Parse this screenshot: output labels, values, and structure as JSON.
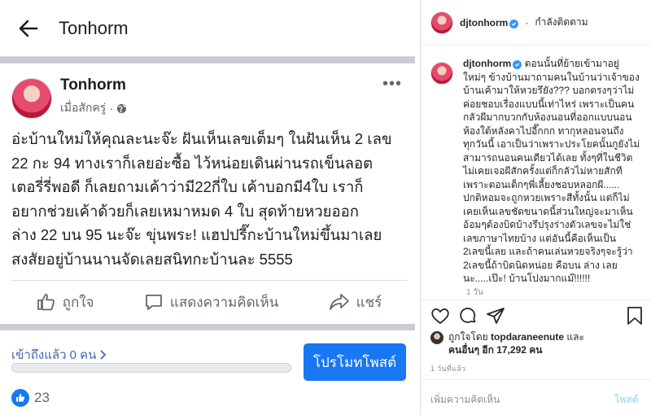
{
  "facebook": {
    "header_title": "Tonhorm",
    "author": "Tonhorm",
    "time": "เมื่อสักครู่",
    "time_sep": "·",
    "body_lines": [
      "อ่ะบ้านใหม่ให้คุณละนะจ๊ะ ฝันเห็นเลขเต็มๆ ในฝันเห็น 2 เลข",
      "22 กะ 94 ทางเราก็เลยอ่ะซื้อ ไว้หน่อยเดินผ่านรถเข็นลอต",
      "เตอรี่รี่พอดี ก็เลยถามเค้าว่ามี22กี่ใบ เค้าบอกมี4ใบ เราก็",
      "อยากช่วยเค้าด้วยก็เลยเหมาหมด 4 ใบ สุดท้ายหวยออก",
      "ล่าง 22 บน 95 นะจ๊ะ ขุ่นพระ! แฮปปรี๊กะบ้านใหม่ขึ้นมาเลย",
      "สงสัยอยู่บ้านนานจัดเลยสนิทกะบ้านละ 5555"
    ],
    "actions": {
      "like": "ถูกใจ",
      "comment": "แสดงความคิดเห็น",
      "share": "แชร์"
    },
    "reach": "เข้าถึงแล้ว 0 คน",
    "reach_progress": 0,
    "boost": "โปรโมทโพสต์",
    "like_count": "23",
    "colors": {
      "brand": "#1877f2",
      "link": "#4267b2"
    }
  },
  "instagram": {
    "username": "djtonhorm",
    "follow_sep": "·",
    "follow_status": "กำลังติดตาม",
    "caption_user": "djtonhorm",
    "caption_lines": [
      "ตอนนั้นที่ย้ายเข้ามาอยู่",
      "ใหม่ๆ ข้างบ้านมาถามคนในบ้านว่าเจ้าของ",
      "บ้านเค้ามาให้หวยรึยัง??? บอกตรงๆว่าไม่",
      "ค่อยชอบเรื่องแบบนี้เท่าไหร่ เพราะเป็นคน",
      "กลัวผีมากบวกกับห้องนอนที่ออกแบบนอน",
      "ห้องใต้หลังคาไปอี๊กกก ทากุหลอนจนถึง",
      "ทุกวันนี้ เอาเป็นว่าเพราะประโยคนั้นกูยังไม่",
      "สามารถนอนคนเดียวได้เลย ทั้งๆที่ในชีวิต",
      "ไม่เคยเจอผีสักครั้งแต่ก็กลัวไม่หายสักที",
      "เพราะตอนเด็กๆพี่เลี้ยงชอบหลอกผี......",
      "ปกติหอมจะถูกหวยเพราะสีทั้งนั้น แต่ก็ไม่",
      "เคยเห็นเลขชัดขนาดนี้ส่วนใหญ่จะมาเห็น",
      "อ้อมๆต้องบิดบ้างรึปรุงร่างตัวเลขจะไม่ใช่",
      "เลขภาษาไทยบ้าง แต่อันนี้คือเห็นเป็น",
      "2เลขนี้เลย และถ้าคนเล่นหวยจริงๆจะรู้ว่า",
      "2เลขนี้ถ้าบิดนิดหน่อย คือบน ล่าง เลย",
      "นะ.....เป๊ะ! บ้านโปงมากแม๊!!!!!!"
    ],
    "age": "1 วัน",
    "liked_by_prefix": "ถูกใจโดย",
    "liked_by_user": "topdaraneenute",
    "liked_by_and": "และ",
    "liked_by_others": "คนอื่นๆ อีก 17,292 คน",
    "date": "1 วันที่แล้ว",
    "add_comment_placeholder": "เพิ่มความคิดเห็น",
    "post_button": "โพสต์",
    "colors": {
      "verified": "#3897f0",
      "post_disabled": "#b2dffc"
    }
  }
}
